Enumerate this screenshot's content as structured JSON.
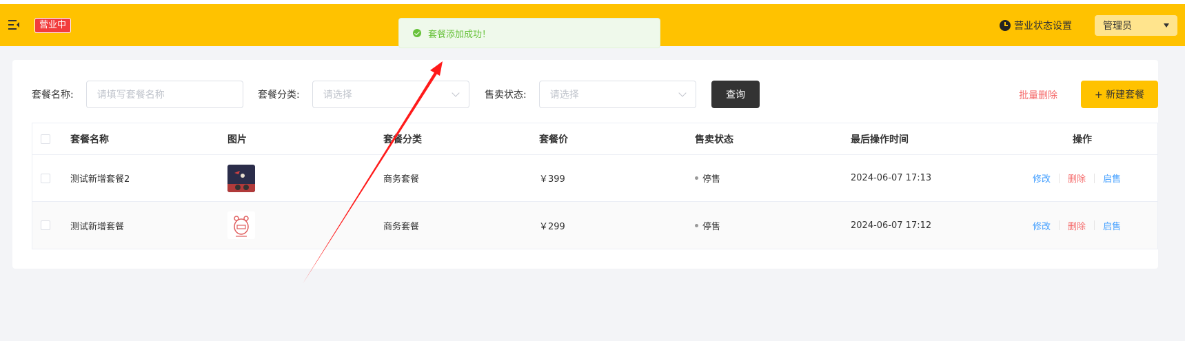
{
  "header": {
    "status_badge": "营业中",
    "biz_status_label": "营业状态设置",
    "user_label": "管理员"
  },
  "toast": {
    "message": "套餐添加成功！"
  },
  "filters": {
    "name_label": "套餐名称:",
    "name_placeholder": "请填写套餐名称",
    "category_label": "套餐分类:",
    "category_placeholder": "请选择",
    "status_label": "售卖状态:",
    "status_placeholder": "请选择",
    "query_button": "查询",
    "batch_delete": "批量删除",
    "new_button": "+ 新建套餐"
  },
  "table": {
    "columns": [
      "套餐名称",
      "图片",
      "套餐分类",
      "套餐价",
      "售卖状态",
      "最后操作时间",
      "操作"
    ],
    "rows": [
      {
        "name": "测试新增套餐2",
        "image": "dark-photo",
        "category": "商务套餐",
        "price": "￥399",
        "status": "停售",
        "updated": "2024-06-07 17:13"
      },
      {
        "name": "测试新增套餐",
        "image": "cartoon-bear",
        "category": "商务套餐",
        "price": "￥299",
        "status": "停售",
        "updated": "2024-06-07 17:12"
      }
    ],
    "actions": {
      "edit": "修改",
      "delete": "删除",
      "toggle_sale": "启售"
    }
  },
  "colors": {
    "brand": "#ffc200",
    "danger": "#f56c6c",
    "link": "#419eff",
    "success": "#67c23a"
  },
  "annotation": {
    "type": "red-arrow",
    "points_to": "toast"
  }
}
